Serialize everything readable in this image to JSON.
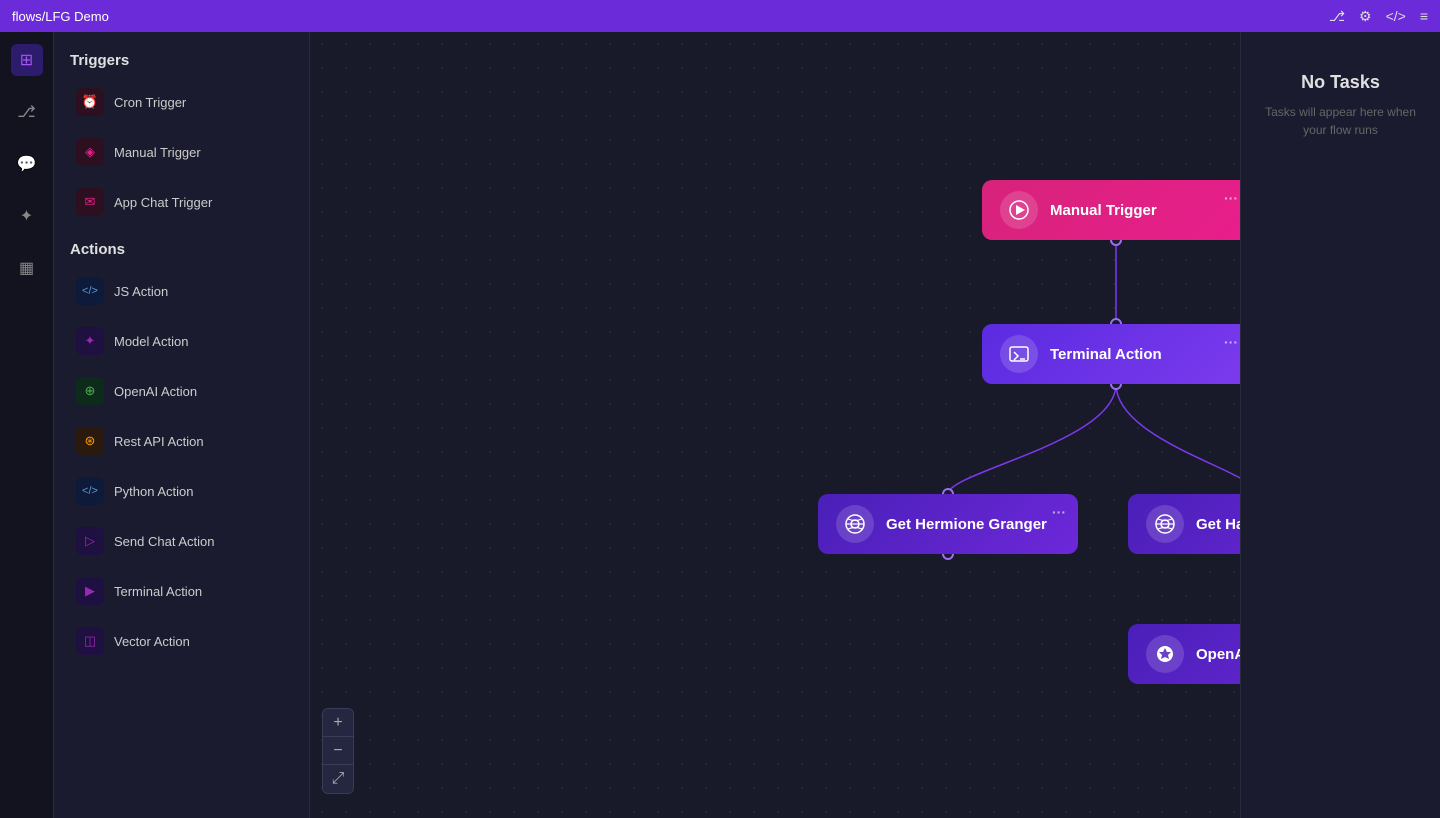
{
  "topbar": {
    "title": "flows/LFG Demo",
    "icons": [
      "fork-icon",
      "settings-icon",
      "code-icon",
      "gear-icon"
    ]
  },
  "nav": {
    "items": [
      {
        "name": "home-nav",
        "icon": "⊞",
        "active": true
      },
      {
        "name": "git-nav",
        "icon": "⎇"
      },
      {
        "name": "chat-nav",
        "icon": "💬"
      },
      {
        "name": "plus-nav",
        "icon": "✦"
      },
      {
        "name": "table-nav",
        "icon": "⊟"
      }
    ]
  },
  "sidebar": {
    "triggers_title": "Triggers",
    "actions_title": "Actions",
    "triggers": [
      {
        "id": "cron-trigger",
        "label": "Cron Trigger",
        "icon": "⏰"
      },
      {
        "id": "manual-trigger",
        "label": "Manual Trigger",
        "icon": "◈"
      },
      {
        "id": "app-chat-trigger",
        "label": "App Chat Trigger",
        "icon": "✉"
      }
    ],
    "actions": [
      {
        "id": "js-action",
        "label": "JS Action",
        "icon": "</>"
      },
      {
        "id": "model-action",
        "label": "Model Action",
        "icon": "✦"
      },
      {
        "id": "openai-action",
        "label": "OpenAI Action",
        "icon": "⊕"
      },
      {
        "id": "rest-api-action",
        "label": "Rest API Action",
        "icon": "⊛"
      },
      {
        "id": "python-action",
        "label": "Python Action",
        "icon": "</>"
      },
      {
        "id": "send-chat-action",
        "label": "Send Chat Action",
        "icon": "▷"
      },
      {
        "id": "terminal-action",
        "label": "Terminal Action",
        "icon": "▶"
      },
      {
        "id": "vector-action",
        "label": "Vector Action",
        "icon": "◫"
      }
    ]
  },
  "canvas": {
    "nodes": [
      {
        "id": "manual-trigger-node",
        "label": "Manual Trigger",
        "type": "trigger",
        "icon": "▶"
      },
      {
        "id": "terminal-action-node",
        "label": "Terminal Action",
        "type": "action",
        "icon": "▶"
      },
      {
        "id": "hermione-node",
        "label": "Get Hermione Granger",
        "type": "action",
        "icon": "⊛"
      },
      {
        "id": "harry-node",
        "label": "Get Harry Potter",
        "type": "action",
        "icon": "⊛"
      },
      {
        "id": "openai-node",
        "label": "OpenAI Action",
        "type": "action",
        "icon": "⊕"
      }
    ]
  },
  "zoom": {
    "plus_label": "+",
    "minus_label": "−",
    "fit_label": "⤢"
  },
  "right_panel": {
    "title": "No Tasks",
    "subtitle": "Tasks will appear here when your flow runs"
  }
}
